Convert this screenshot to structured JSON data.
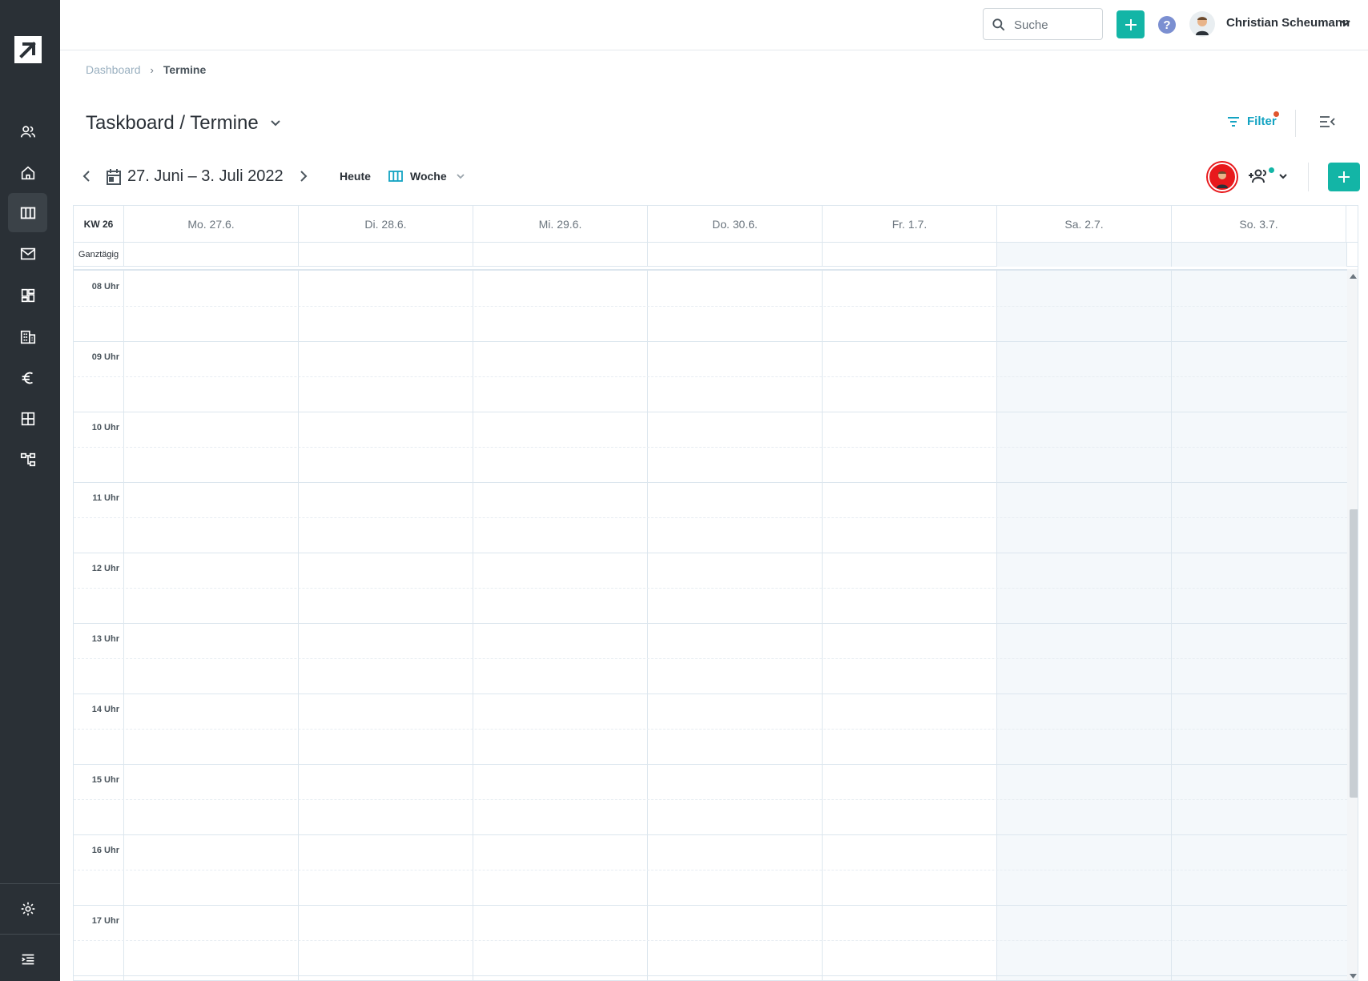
{
  "app": {
    "name": "Taskboard"
  },
  "topbar": {
    "search_placeholder": "Suche",
    "user_name": "Christian Scheumann"
  },
  "breadcrumb": {
    "items": [
      {
        "label": "Dashboard"
      },
      {
        "label": "Termine"
      }
    ]
  },
  "page": {
    "title": "Taskboard / Termine"
  },
  "filter": {
    "label": "Filter"
  },
  "calendar": {
    "date_range": "27. Juni – 3. Juli 2022",
    "today_label": "Heute",
    "view_label": "Woche",
    "week_label": "KW 26",
    "allday_label": "Ganztägig",
    "days": [
      "Mo. 27.6.",
      "Di. 28.6.",
      "Mi. 29.6.",
      "Do. 30.6.",
      "Fr. 1.7.",
      "Sa. 2.7.",
      "So. 3.7."
    ],
    "hours": [
      "08 Uhr",
      "09 Uhr",
      "10 Uhr",
      "11 Uhr",
      "12 Uhr",
      "13 Uhr",
      "14 Uhr",
      "15 Uhr",
      "16 Uhr",
      "17 Uhr"
    ]
  },
  "colors": {
    "accent": "#13b5a6",
    "sidebar": "#2a3036",
    "link": "#13a3c2",
    "notification": "#e0562f"
  }
}
